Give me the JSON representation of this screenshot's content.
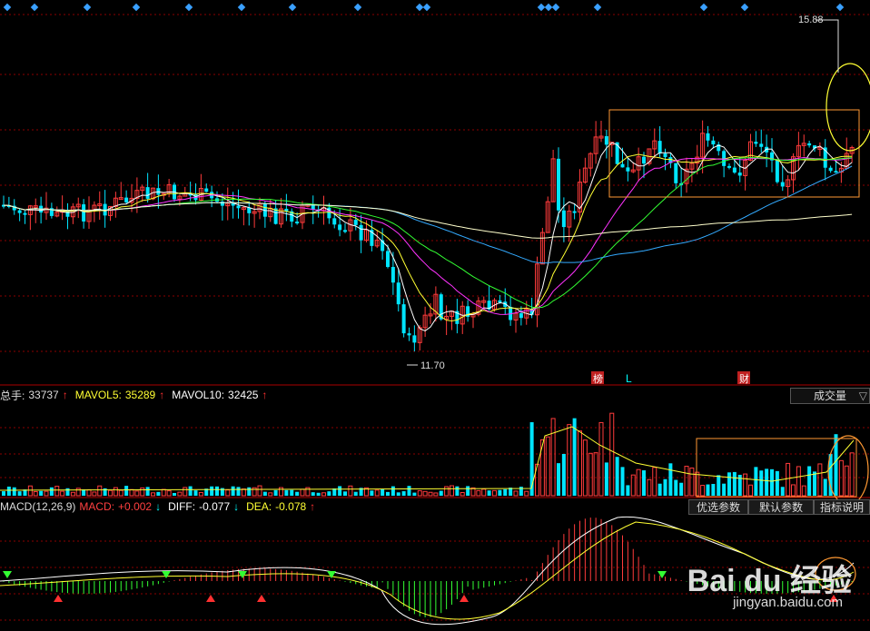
{
  "chart_data": {
    "type": "candlestick",
    "price_labels": {
      "high": "15.88",
      "low": "11.70"
    },
    "markers": [
      {
        "text": "榜",
        "bg": "#c02020",
        "color": "#ffffff"
      },
      {
        "text": "L",
        "bg": "",
        "color": "#00ffff"
      },
      {
        "text": "财",
        "bg": "#c02020",
        "color": "#ffffff"
      }
    ],
    "volume": {
      "total_label": "总手:",
      "total_value": "33737",
      "mavol5_label": "MAVOL5:",
      "mavol5_value": "35289",
      "mavol10_label": "MAVOL10:",
      "mavol10_value": "32425",
      "dropdown_label": "成交量"
    },
    "macd": {
      "title": "MACD(12,26,9)",
      "macd_label": "MACD:",
      "macd_value": "+0.002",
      "diff_label": "DIFF:",
      "diff_value": "-0.077",
      "dea_label": "DEA:",
      "dea_value": "-0.078",
      "buttons": [
        "优选参数",
        "默认参数",
        "指标说明"
      ]
    },
    "colors": {
      "up": "#ff3b3b",
      "down": "#00e5ff",
      "ma5": "#ffffff",
      "ma10": "#ffff33",
      "ma20": "#ff33ff",
      "ma30": "#33ff33",
      "ma60": "#33aaff",
      "ma120": "#ffffcc"
    }
  },
  "watermark": {
    "logo": "Bai du 经验",
    "url": "jingyan.baidu.com"
  }
}
